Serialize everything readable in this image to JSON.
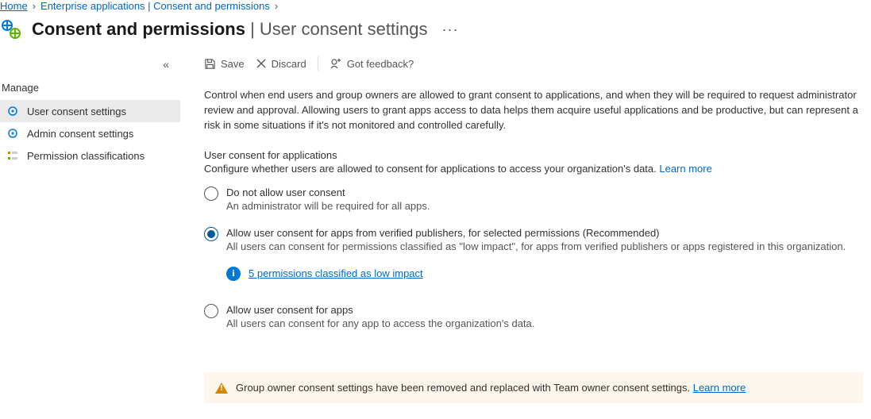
{
  "breadcrumb": {
    "items": [
      "Home",
      "Enterprise applications | Consent and permissions"
    ]
  },
  "header": {
    "title_main": "Consent and permissions",
    "title_sep": " | ",
    "title_sub": "User consent settings"
  },
  "sidebar": {
    "section": "Manage",
    "items": [
      {
        "label": "User consent settings"
      },
      {
        "label": "Admin consent settings"
      },
      {
        "label": "Permission classifications"
      }
    ]
  },
  "toolbar": {
    "save": "Save",
    "discard": "Discard",
    "feedback": "Got feedback?"
  },
  "main": {
    "description": "Control when end users and group owners are allowed to grant consent to applications, and when they will be required to request administrator review and approval. Allowing users to grant apps access to data helps them acquire useful applications and be productive, but can represent a risk in some situations if it's not monitored and controlled carefully.",
    "section_title": "User consent for applications",
    "section_sub_prefix": "Configure whether users are allowed to consent for applications to access your organization's data. ",
    "section_sub_link": "Learn more",
    "options": [
      {
        "label": "Do not allow user consent",
        "help": "An administrator will be required for all apps."
      },
      {
        "label": "Allow user consent for apps from verified publishers, for selected permissions (Recommended)",
        "help": "All users can consent for permissions classified as \"low impact\", for apps from verified publishers or apps registered in this organization."
      },
      {
        "label": "Allow user consent for apps",
        "help": "All users can consent for any app to access the organization's data."
      }
    ],
    "info_link": "5 permissions classified as low impact",
    "banner_text": "Group owner consent settings have been removed and replaced with Team owner consent settings. ",
    "banner_link": "Learn more"
  }
}
